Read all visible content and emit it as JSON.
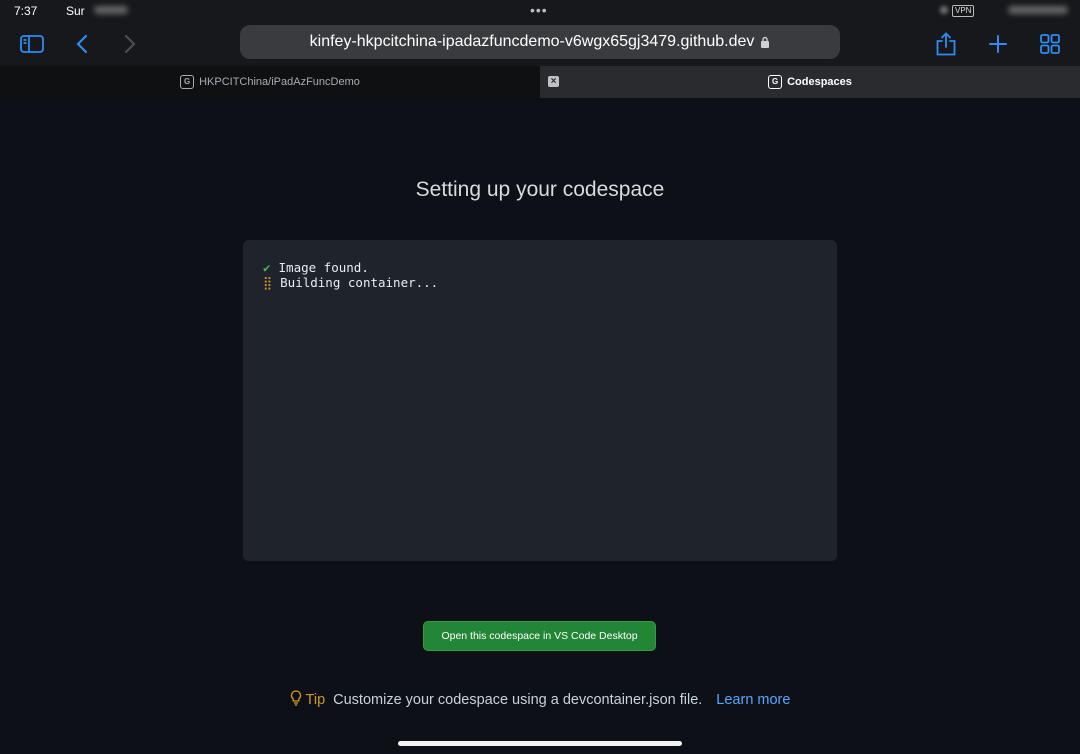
{
  "status": {
    "time": "7:37",
    "carrier": "Sur",
    "vpn": "VPN"
  },
  "toolbar": {
    "url": "kinfey-hkpcitchina-ipadazfuncdemo-v6wgx65gj3479.github.dev"
  },
  "tabs": [
    {
      "label": "HKPCITChina/iPadAzFuncDemo",
      "favicon": "G"
    },
    {
      "label": "Codespaces",
      "favicon": "G"
    }
  ],
  "main": {
    "title": "Setting up your codespace",
    "log": [
      {
        "status": "✔",
        "text": "Image found."
      },
      {
        "status": "⣿",
        "text": "Building container..."
      }
    ],
    "open_button": "Open this codespace in VS Code Desktop"
  },
  "tip": {
    "label": "Tip",
    "text": "Customize your codespace using a devcontainer.json file.",
    "link": "Learn more"
  },
  "colors": {
    "accent": "#2e8cf3",
    "button": "#238636",
    "tip": "#d29922",
    "link": "#58a6ff"
  }
}
